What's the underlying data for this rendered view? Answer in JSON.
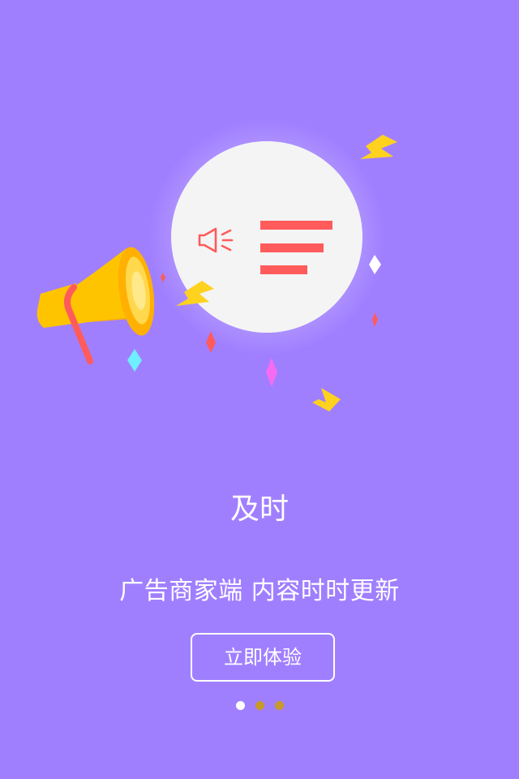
{
  "colors": {
    "background": "#a07fff",
    "circle": "#f4f4f4",
    "accent_red": "#ff5b5b",
    "megaphone_yellow": "#ffc400",
    "megaphone_dark": "#ffb000",
    "bolt_yellow": "#ffd21f",
    "dot_active": "#ffffff",
    "dot_inactive": "#c79a2b",
    "gem_cyan": "#6fefff",
    "gem_magenta": "#f56cf3",
    "gem_red": "#ff5b5b",
    "gem_white": "#ffffff"
  },
  "illustration": {
    "icons": [
      "speaker-icon",
      "text-lines-icon",
      "megaphone-icon",
      "lightning-icon",
      "sparkle-icon"
    ]
  },
  "onboarding": {
    "title": "及时",
    "subtitle": "广告商家端  内容时时更新",
    "button_label": "立即体验",
    "current_page": 1,
    "total_pages": 3
  }
}
